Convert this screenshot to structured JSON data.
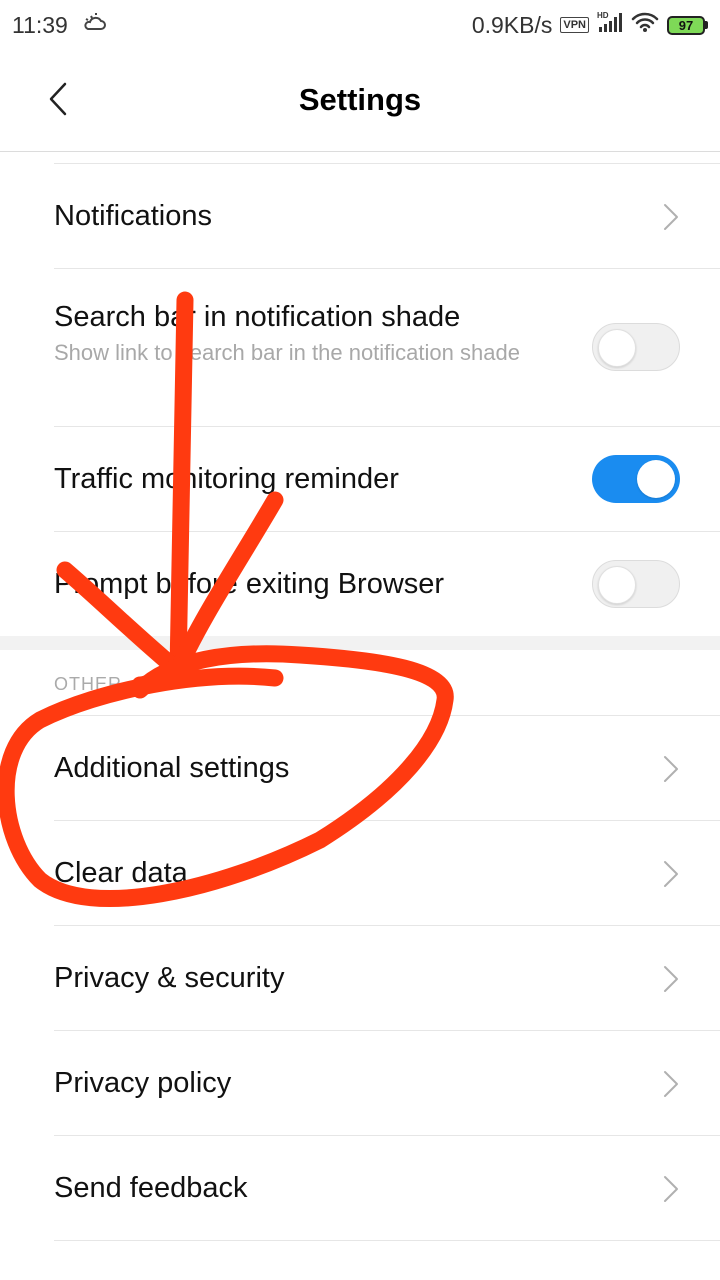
{
  "status_bar": {
    "time": "11:39",
    "weather_icon": "cloud-sun-icon",
    "network_speed": "0.9KB/s",
    "vpn_label": "VPN",
    "battery_level": "97",
    "battery_color": "#7ed957"
  },
  "header": {
    "title": "Settings",
    "back_icon": "chevron-left-icon"
  },
  "items": {
    "notifications": "Notifications",
    "search_bar": {
      "label": "Search bar in notification shade",
      "description": "Show link to search bar in the notification shade",
      "enabled": false
    },
    "traffic": {
      "label": "Traffic monitoring reminder",
      "enabled": true
    },
    "prompt_exit": {
      "label": "Prompt before exiting Browser",
      "enabled": false
    },
    "section_other": "OTHER",
    "additional_settings": "Additional settings",
    "clear_data": "Clear data",
    "privacy_security": "Privacy & security",
    "privacy_policy": "Privacy policy",
    "send_feedback": "Send feedback"
  },
  "colors": {
    "toggle_on": "#1a8cf0",
    "annotation_red": "#ff3a10"
  }
}
